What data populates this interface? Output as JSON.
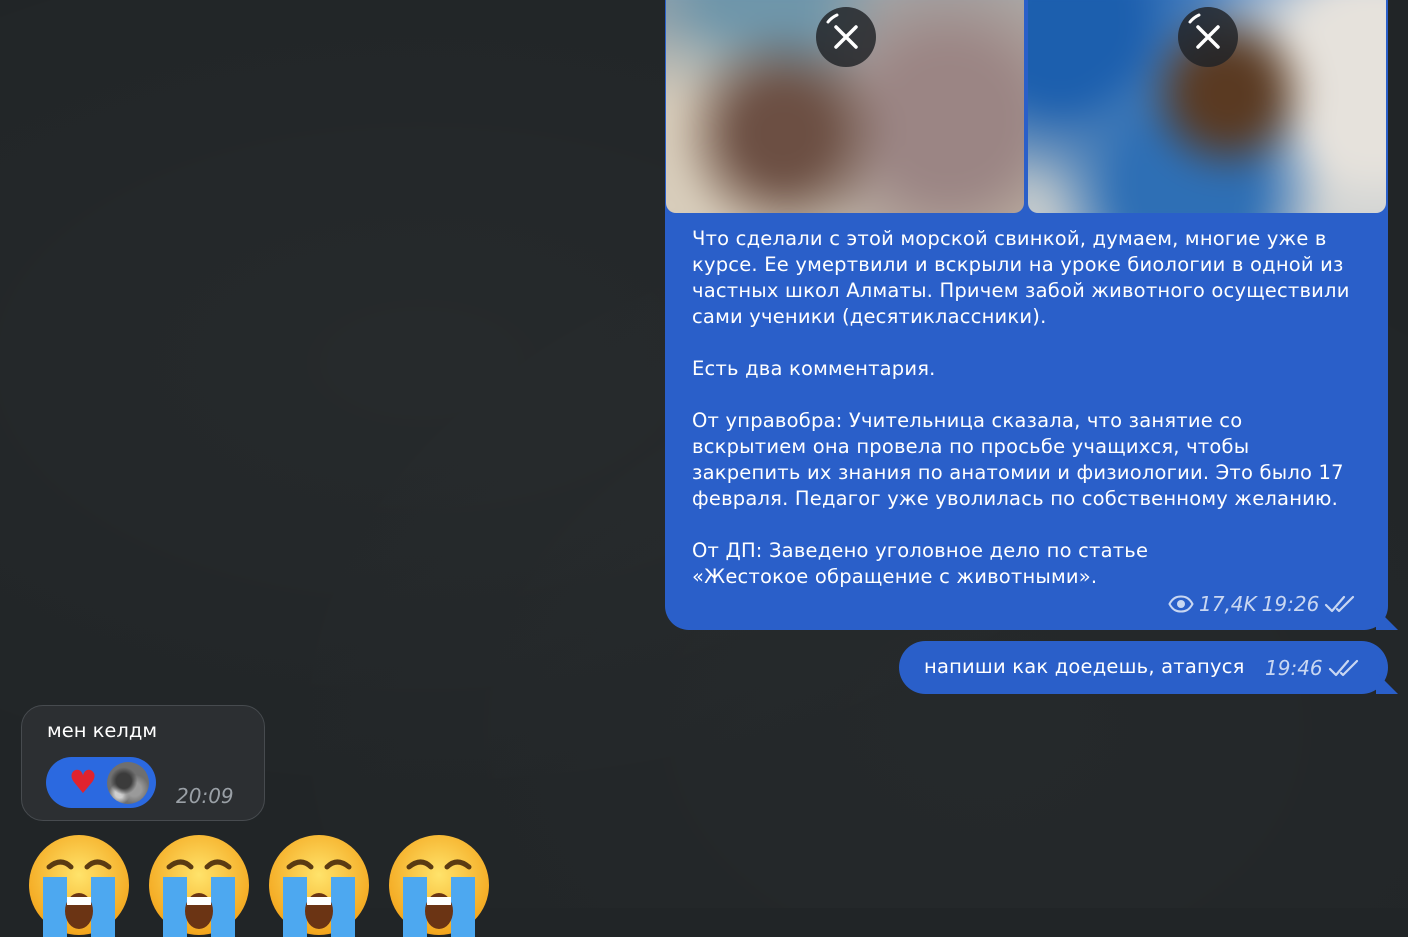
{
  "channel_post": {
    "paragraphs": [
      "Что сделали с этой морской свинкой, думаем, многие уже в курсе. Ее умертвили и вскрыли на уроке биологии в одной из частных школ Алматы. Причем забой животного осуществили сами ученики (десятиклассники).",
      "Есть два комментария.",
      "От управобра: Учительница сказала, что занятие со вскрытием она провела по просьбе учащихся, чтобы закрепить их знания по анатомии и физиологии. Это было 17 февраля. Педагог уже уволилась по собственному желанию.",
      "От ДП: Заведено уголовное дело по статье «Жестокое обращение с животными»."
    ],
    "views": "17,4K",
    "time": "19:26",
    "media_count": 2
  },
  "outgoing_message": {
    "text": "напиши как доедешь, атапуся",
    "time": "19:46"
  },
  "incoming_message": {
    "text": "мен келдм",
    "reaction": "♥",
    "time": "20:09"
  },
  "emoji_row": [
    "😭",
    "😭",
    "😭",
    "😭"
  ],
  "colors": {
    "background": "#212527",
    "outgoing_bubble": "#2a5fc9",
    "incoming_bubble": "#2c2f32",
    "reaction_pill": "#2b69e0"
  }
}
